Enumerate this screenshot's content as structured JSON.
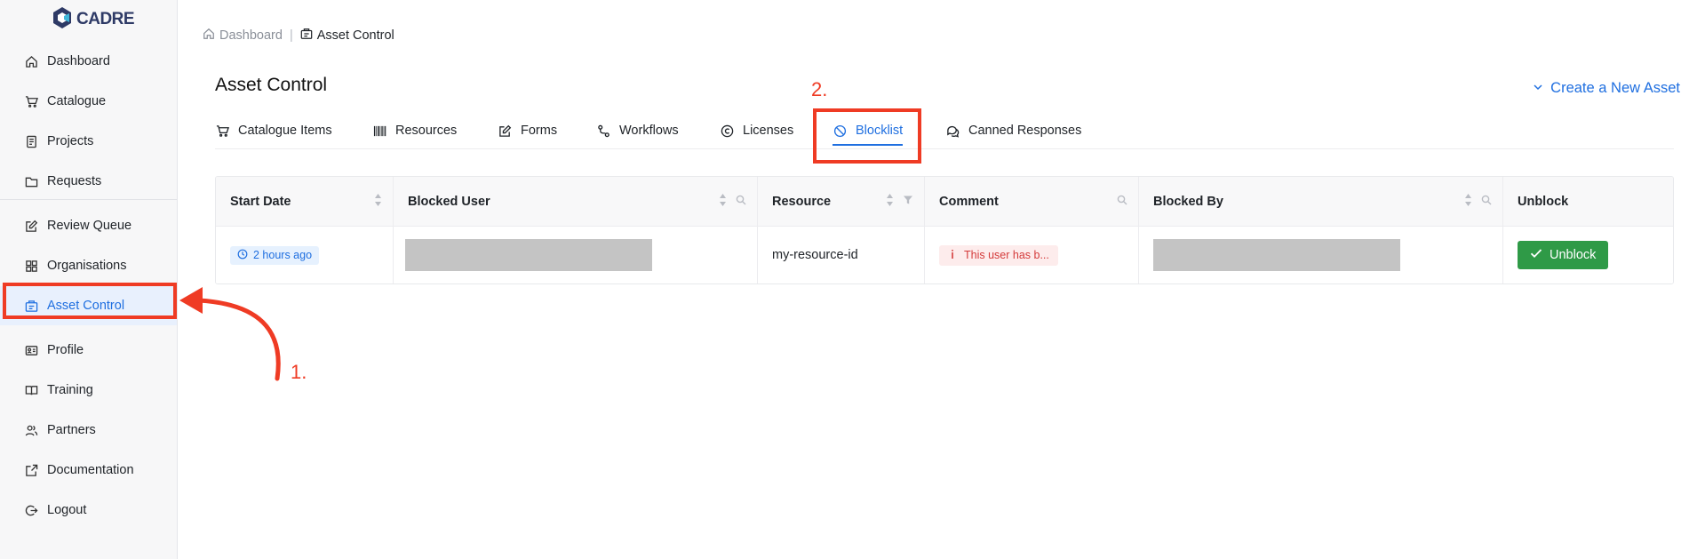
{
  "app": {
    "logo_text": "CADRE"
  },
  "sidebar": {
    "items": [
      {
        "label": "Dashboard",
        "icon": "home-icon"
      },
      {
        "label": "Catalogue",
        "icon": "cart-icon"
      },
      {
        "label": "Projects",
        "icon": "document-icon"
      },
      {
        "label": "Requests",
        "icon": "folder-icon"
      },
      {
        "label": "Review Queue",
        "icon": "edit-icon"
      },
      {
        "label": "Organisations",
        "icon": "grid-icon"
      },
      {
        "label": "Asset Control",
        "icon": "assets-icon",
        "active": true
      },
      {
        "label": "Profile",
        "icon": "id-card-icon"
      },
      {
        "label": "Training",
        "icon": "book-icon"
      },
      {
        "label": "Partners",
        "icon": "users-icon"
      },
      {
        "label": "Documentation",
        "icon": "external-link-icon"
      },
      {
        "label": "Logout",
        "icon": "logout-icon"
      }
    ]
  },
  "breadcrumb": {
    "home": "Dashboard",
    "separator": "|",
    "current": "Asset Control"
  },
  "page": {
    "title": "Asset Control",
    "create_link": "Create a New Asset"
  },
  "tabs": [
    {
      "label": "Catalogue Items",
      "icon": "cart-icon"
    },
    {
      "label": "Resources",
      "icon": "barcode-icon"
    },
    {
      "label": "Forms",
      "icon": "edit-icon"
    },
    {
      "label": "Workflows",
      "icon": "workflow-icon"
    },
    {
      "label": "Licenses",
      "icon": "copyright-icon"
    },
    {
      "label": "Blocklist",
      "icon": "block-icon",
      "active": true
    },
    {
      "label": "Canned Responses",
      "icon": "chat-icon"
    }
  ],
  "table": {
    "columns": [
      "Start Date",
      "Blocked User",
      "Resource",
      "Comment",
      "Blocked By",
      "Unblock"
    ],
    "rows": [
      {
        "start_date": "2 hours ago",
        "resource": "my-resource-id",
        "comment": "This user has b...",
        "unblock_label": "Unblock"
      }
    ]
  },
  "annotations": {
    "label_1": "1.",
    "label_2": "2."
  },
  "colors": {
    "accent": "#1f6fe0",
    "annotation": "#ef3b24",
    "success": "#2f9a47",
    "error": "#d43b3b"
  }
}
